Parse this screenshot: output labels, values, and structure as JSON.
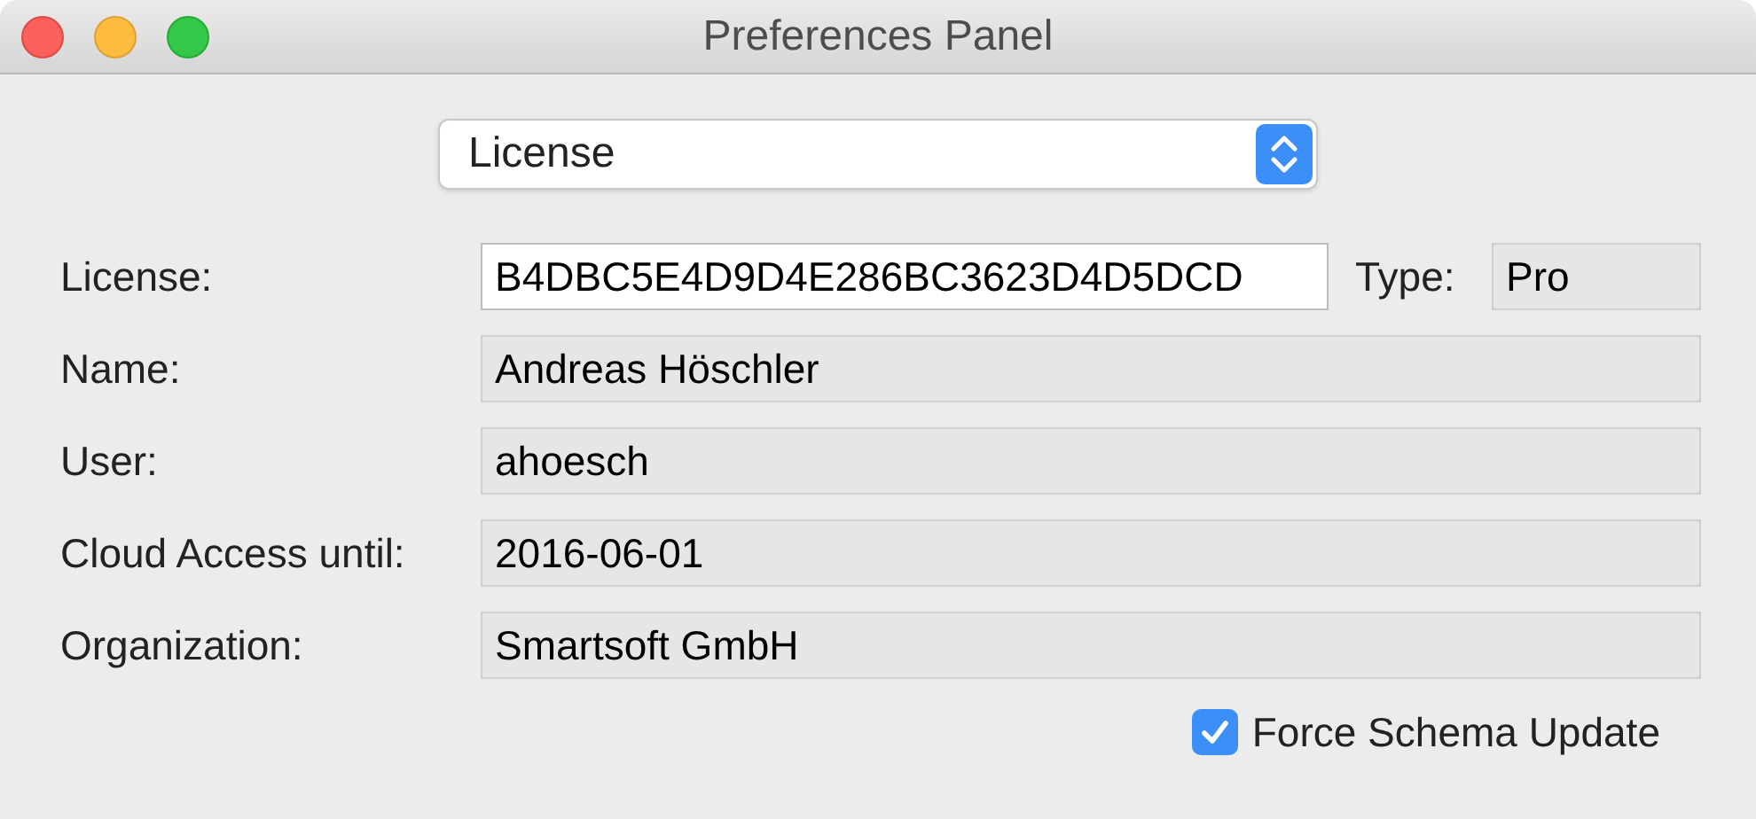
{
  "window": {
    "title": "Preferences Panel"
  },
  "section_popup": {
    "value": "License"
  },
  "fields": [
    {
      "label": "License:",
      "value": "B4DBC5E4D9D4E286BC3623D4D5DCD",
      "editable": true,
      "extra": {
        "label": "Type:",
        "value": "Pro",
        "editable": false
      }
    },
    {
      "label": "Name:",
      "value": "Andreas Höschler",
      "editable": false
    },
    {
      "label": "User:",
      "value": "ahoesch",
      "editable": false
    },
    {
      "label": "Cloud Access until:",
      "value": "2016-06-01",
      "editable": false
    },
    {
      "label": "Organization:",
      "value": "Smartsoft GmbH",
      "editable": false
    }
  ],
  "force_schema_update": {
    "label": "Force Schema Update",
    "checked": true
  }
}
